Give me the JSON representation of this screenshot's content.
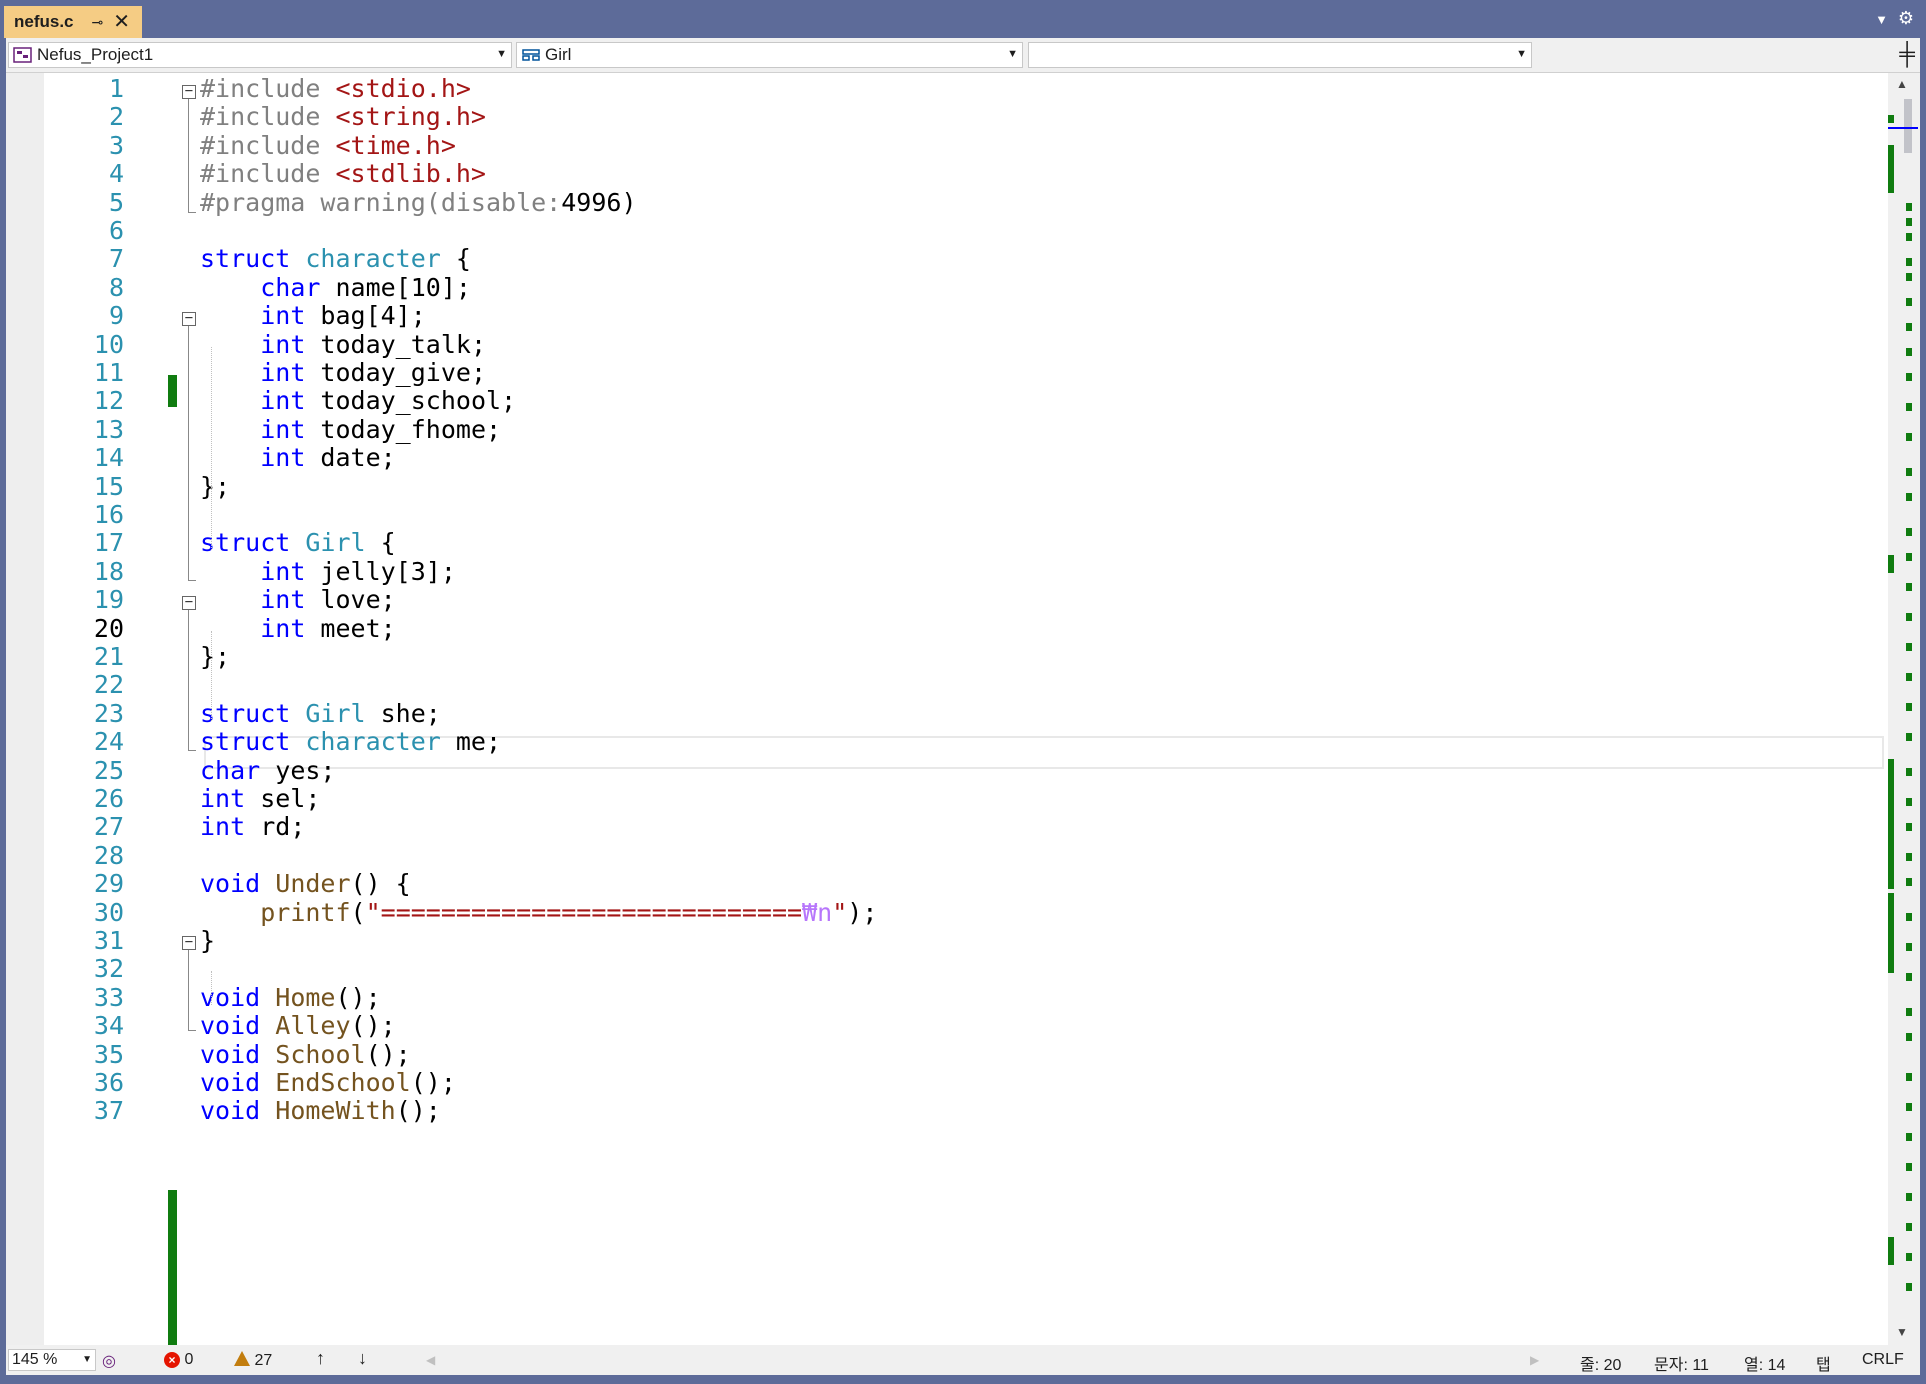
{
  "tab": {
    "title": "nefus.c",
    "pin_icon": "pin-icon",
    "close_icon": "close-icon"
  },
  "navbar": {
    "project": "Nefus_Project1",
    "scope": "Girl",
    "member": ""
  },
  "editor": {
    "current_line": 20,
    "lines": [
      {
        "n": "1",
        "tokens": [
          {
            "t": "#include ",
            "c": "pp"
          },
          {
            "t": "<stdio.h>",
            "c": "str"
          }
        ]
      },
      {
        "n": "2",
        "tokens": [
          {
            "t": "#include ",
            "c": "pp"
          },
          {
            "t": "<string.h>",
            "c": "str"
          }
        ]
      },
      {
        "n": "3",
        "tokens": [
          {
            "t": "#include ",
            "c": "pp"
          },
          {
            "t": "<time.h>",
            "c": "str"
          }
        ]
      },
      {
        "n": "4",
        "tokens": [
          {
            "t": "#include ",
            "c": "pp"
          },
          {
            "t": "<stdlib.h>",
            "c": "str"
          }
        ]
      },
      {
        "n": "5",
        "tokens": [
          {
            "t": "#pragma warning(disable:",
            "c": "pp"
          },
          {
            "t": "4996",
            "c": ""
          },
          {
            "t": ")",
            "c": ""
          }
        ]
      },
      {
        "n": "6",
        "tokens": []
      },
      {
        "n": "7",
        "tokens": [
          {
            "t": "struct ",
            "c": "kw"
          },
          {
            "t": "character",
            "c": "ty"
          },
          {
            "t": " {",
            "c": ""
          }
        ]
      },
      {
        "n": "8",
        "tokens": [
          {
            "t": "    ",
            "c": ""
          },
          {
            "t": "char",
            "c": "kw"
          },
          {
            "t": " name[10];",
            "c": ""
          }
        ]
      },
      {
        "n": "9",
        "tokens": [
          {
            "t": "    ",
            "c": ""
          },
          {
            "t": "int",
            "c": "kw"
          },
          {
            "t": " bag[4];",
            "c": ""
          }
        ]
      },
      {
        "n": "10",
        "tokens": [
          {
            "t": "    ",
            "c": ""
          },
          {
            "t": "int",
            "c": "kw"
          },
          {
            "t": " today_talk;",
            "c": ""
          }
        ]
      },
      {
        "n": "11",
        "tokens": [
          {
            "t": "    ",
            "c": ""
          },
          {
            "t": "int",
            "c": "kw"
          },
          {
            "t": " today_give;",
            "c": ""
          }
        ]
      },
      {
        "n": "12",
        "tokens": [
          {
            "t": "    ",
            "c": ""
          },
          {
            "t": "int",
            "c": "kw"
          },
          {
            "t": " today_school;",
            "c": ""
          }
        ]
      },
      {
        "n": "13",
        "tokens": [
          {
            "t": "    ",
            "c": ""
          },
          {
            "t": "int",
            "c": "kw"
          },
          {
            "t": " today_fhome;",
            "c": ""
          }
        ]
      },
      {
        "n": "14",
        "tokens": [
          {
            "t": "    ",
            "c": ""
          },
          {
            "t": "int",
            "c": "kw"
          },
          {
            "t": " date;",
            "c": ""
          }
        ]
      },
      {
        "n": "15",
        "tokens": [
          {
            "t": "};",
            "c": ""
          }
        ]
      },
      {
        "n": "16",
        "tokens": []
      },
      {
        "n": "17",
        "tokens": [
          {
            "t": "struct ",
            "c": "kw"
          },
          {
            "t": "Girl",
            "c": "ty"
          },
          {
            "t": " {",
            "c": ""
          }
        ]
      },
      {
        "n": "18",
        "tokens": [
          {
            "t": "    ",
            "c": ""
          },
          {
            "t": "int",
            "c": "kw"
          },
          {
            "t": " jelly[3];",
            "c": ""
          }
        ]
      },
      {
        "n": "19",
        "tokens": [
          {
            "t": "    ",
            "c": ""
          },
          {
            "t": "int",
            "c": "kw"
          },
          {
            "t": " love;",
            "c": ""
          }
        ]
      },
      {
        "n": "20",
        "tokens": [
          {
            "t": "    ",
            "c": ""
          },
          {
            "t": "int",
            "c": "kw"
          },
          {
            "t": " meet;",
            "c": ""
          }
        ]
      },
      {
        "n": "21",
        "tokens": [
          {
            "t": "};",
            "c": ""
          }
        ]
      },
      {
        "n": "22",
        "tokens": []
      },
      {
        "n": "23",
        "tokens": [
          {
            "t": "struct ",
            "c": "kw"
          },
          {
            "t": "Girl",
            "c": "ty"
          },
          {
            "t": " she;",
            "c": ""
          }
        ]
      },
      {
        "n": "24",
        "tokens": [
          {
            "t": "struct ",
            "c": "kw"
          },
          {
            "t": "character",
            "c": "ty"
          },
          {
            "t": " me;",
            "c": ""
          }
        ]
      },
      {
        "n": "25",
        "tokens": [
          {
            "t": "char",
            "c": "kw"
          },
          {
            "t": " yes;",
            "c": ""
          }
        ]
      },
      {
        "n": "26",
        "tokens": [
          {
            "t": "int",
            "c": "kw"
          },
          {
            "t": " sel;",
            "c": ""
          }
        ]
      },
      {
        "n": "27",
        "tokens": [
          {
            "t": "int",
            "c": "kw"
          },
          {
            "t": " rd;",
            "c": ""
          }
        ]
      },
      {
        "n": "28",
        "tokens": []
      },
      {
        "n": "29",
        "tokens": [
          {
            "t": "void ",
            "c": "kw"
          },
          {
            "t": "Under",
            "c": "fn"
          },
          {
            "t": "() {",
            "c": ""
          }
        ]
      },
      {
        "n": "30",
        "tokens": [
          {
            "t": "    ",
            "c": ""
          },
          {
            "t": "printf",
            "c": "fn"
          },
          {
            "t": "(",
            "c": ""
          },
          {
            "t": "\"============================",
            "c": "str"
          },
          {
            "t": "₩n",
            "c": "esc"
          },
          {
            "t": "\"",
            "c": "str"
          },
          {
            "t": ");",
            "c": ""
          }
        ]
      },
      {
        "n": "31",
        "tokens": [
          {
            "t": "}",
            "c": ""
          }
        ]
      },
      {
        "n": "32",
        "tokens": []
      },
      {
        "n": "33",
        "tokens": [
          {
            "t": "void ",
            "c": "kw"
          },
          {
            "t": "Home",
            "c": "fn"
          },
          {
            "t": "();",
            "c": ""
          }
        ]
      },
      {
        "n": "34",
        "tokens": [
          {
            "t": "void ",
            "c": "kw"
          },
          {
            "t": "Alley",
            "c": "fn"
          },
          {
            "t": "();",
            "c": ""
          }
        ]
      },
      {
        "n": "35",
        "tokens": [
          {
            "t": "void ",
            "c": "kw"
          },
          {
            "t": "School",
            "c": "fn"
          },
          {
            "t": "();",
            "c": ""
          }
        ]
      },
      {
        "n": "36",
        "tokens": [
          {
            "t": "void ",
            "c": "kw"
          },
          {
            "t": "EndSchool",
            "c": "fn"
          },
          {
            "t": "();",
            "c": ""
          }
        ]
      },
      {
        "n": "37",
        "tokens": [
          {
            "t": "void ",
            "c": "kw"
          },
          {
            "t": "HomeWith",
            "c": "fn"
          },
          {
            "t": "();",
            "c": ""
          }
        ]
      }
    ]
  },
  "status": {
    "zoom": "145 %",
    "errors": "0",
    "warnings": "27",
    "line": "줄: 20",
    "char": "문자: 11",
    "col": "열: 14",
    "indent": "탭",
    "eol": "CRLF"
  },
  "colors": {
    "chrome": "#5d6b99",
    "tab_active": "#f5cc84",
    "change_green": "#107c10",
    "keyword": "#0000ff",
    "type": "#2b91af",
    "string": "#a31515"
  }
}
